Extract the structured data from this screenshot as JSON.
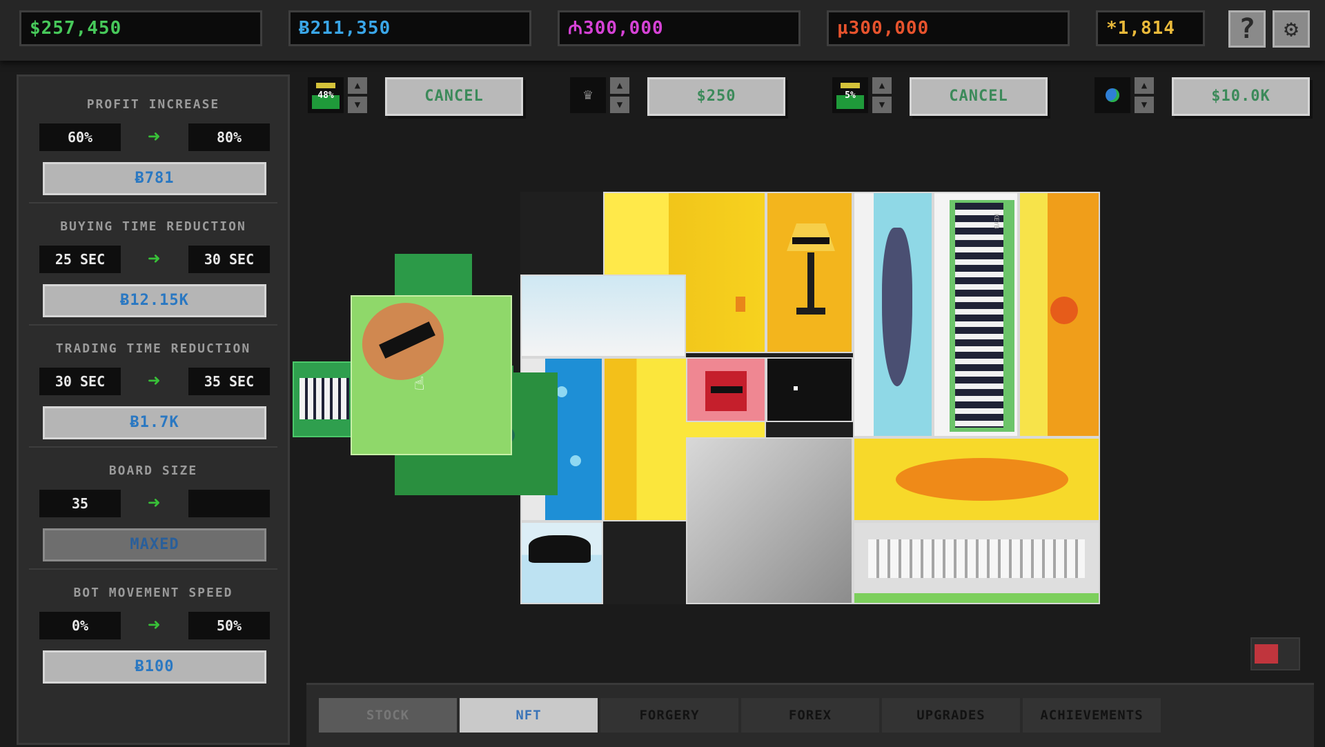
{
  "currencies": [
    {
      "value": "$257,450",
      "color": "#47c95a"
    },
    {
      "value": "Ƀ211,350",
      "color": "#3aa6e8"
    },
    {
      "value": "₼300,000",
      "color": "#d642d6"
    },
    {
      "value": "µ300,000",
      "color": "#e7532d"
    },
    {
      "value": "*1,814",
      "color": "#e9b93a"
    }
  ],
  "top_icons": {
    "help": "?",
    "settings": "⚙"
  },
  "upgrades": [
    {
      "title": "PROFIT INCREASE",
      "from": "60%",
      "to": "80%",
      "cost": "Ƀ781"
    },
    {
      "title": "BUYING TIME REDUCTION",
      "from": "25 SEC",
      "to": "30 SEC",
      "cost": "Ƀ12.15K"
    },
    {
      "title": "TRADING TIME REDUCTION",
      "from": "30 SEC",
      "to": "35 SEC",
      "cost": "Ƀ1.7K"
    },
    {
      "title": "BOARD SIZE",
      "from": "35",
      "to": "",
      "cost": "MAXED"
    },
    {
      "title": "BOT MOVEMENT SPEED",
      "from": "0%",
      "to": "50%",
      "cost": "Ƀ100"
    }
  ],
  "controls": [
    {
      "icon_text": "48%",
      "icon": "bar-chart-icon",
      "action": "CANCEL"
    },
    {
      "icon_text": "",
      "icon": "crown-icon",
      "action": "$250"
    },
    {
      "icon_text": "5%",
      "icon": "bar-chart-icon",
      "action": "CANCEL"
    },
    {
      "icon_text": "",
      "icon": "globe-icon",
      "action": "$10.0K"
    }
  ],
  "tabs": [
    {
      "label": "STOCK",
      "state": "disabled"
    },
    {
      "label": "NFT",
      "state": "active"
    },
    {
      "label": "FORGERY",
      "state": "normal"
    },
    {
      "label": "FOREX",
      "state": "normal"
    },
    {
      "label": "UPGRADES",
      "state": "normal"
    },
    {
      "label": "ACHIEVEMENTS",
      "state": "normal"
    }
  ],
  "board_text": {
    "keyboard": "KEYB"
  }
}
